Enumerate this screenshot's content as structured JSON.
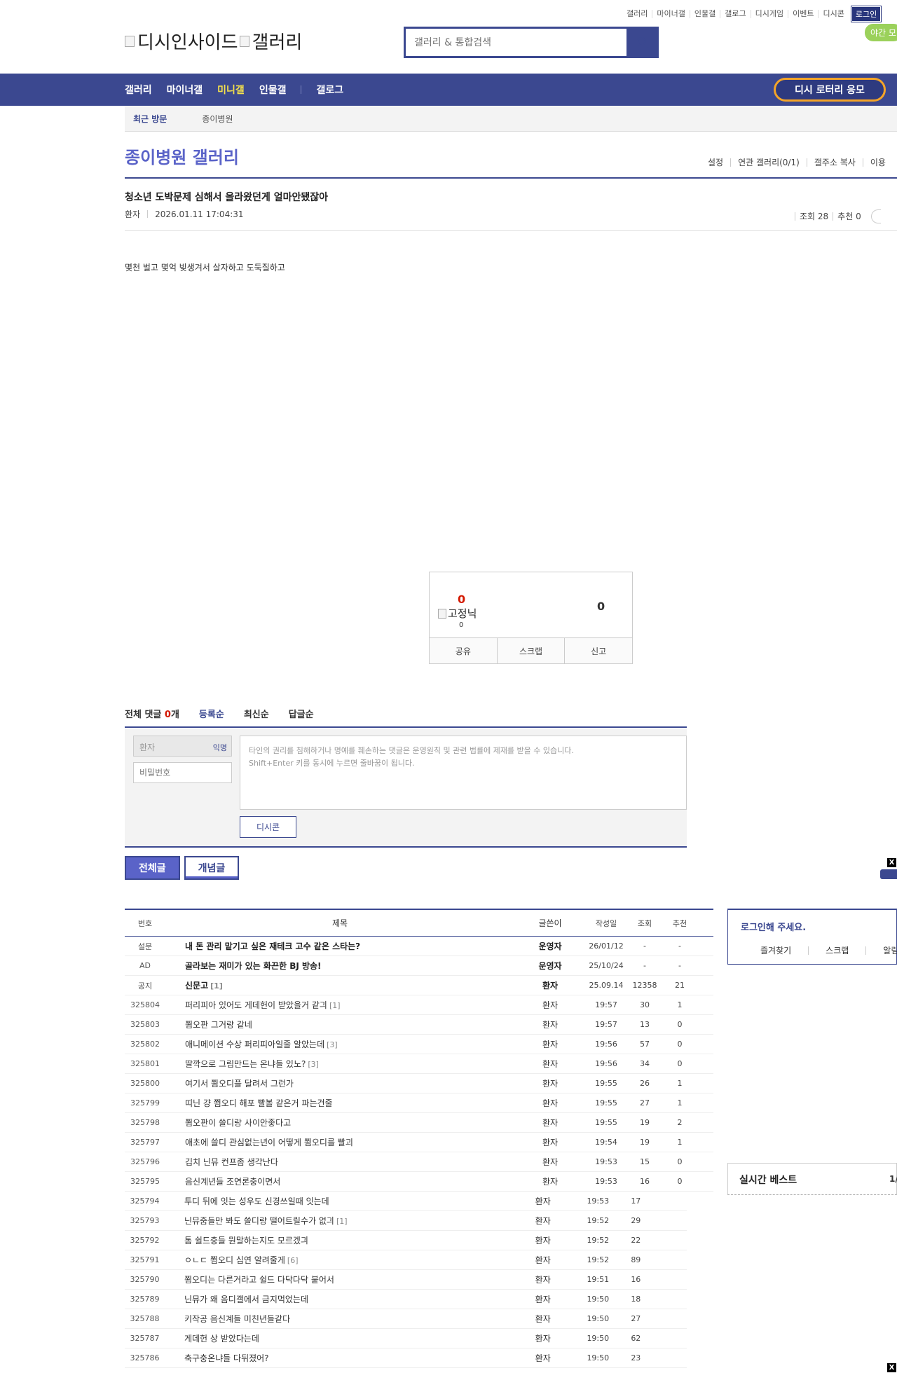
{
  "topmenu": {
    "items": [
      "갤러리",
      "마이너갤",
      "인물갤",
      "갤로그",
      "디시게임",
      "이벤트",
      "디시콘"
    ],
    "login_label": "로그인",
    "night_label": "야간 모"
  },
  "logo": {
    "site_alt": "디시인사이드",
    "gallery_alt": "갤러리"
  },
  "search": {
    "placeholder": "갤러리 & 통합검색"
  },
  "gnb": {
    "items": [
      "갤러리",
      "마이너갤",
      "미니갤",
      "인물갤"
    ],
    "extra": "갤로그",
    "lotto_label": "디시 로터리 응모"
  },
  "visit": {
    "title": "최근 방문",
    "gallery": "종이병원"
  },
  "gallery": {
    "title": "종이병원 갤러리",
    "options": [
      "설정",
      "연관 갤러리(0/1)",
      "갤주소 복사",
      "이용"
    ]
  },
  "post": {
    "title": "청소년 도박문제 심해서 올라왔던게 얼마안됐잖아",
    "writer": "환자",
    "datetime": "2026.01.11 17:04:31",
    "views_label": "조회 28",
    "rec_label": "추천 0",
    "body": "몇천 벌고 몇억 빚생겨서 살자하고 도둑질하고"
  },
  "recommend": {
    "up": "0",
    "fixed_alt": "고정닉",
    "fixed_count": "0",
    "down": "0",
    "buttons": [
      "공유",
      "스크랩",
      "신고"
    ]
  },
  "comments": {
    "total_label": "전체 댓글",
    "total_count": "0",
    "total_unit": "개",
    "sorts": [
      "등록순",
      "최신순",
      "답글순"
    ],
    "nick": "환자",
    "anon_label": "익명",
    "pw_placeholder": "비밀번호",
    "notice_line1": "타인의 권리를 침해하거나 명예를 훼손하는 댓글은 운영원칙 및 관련 법률에 제재를 받을 수 있습니다.",
    "notice_line2": "Shift+Enter 키를 동시에 누르면 줄바꿈이 됩니다.",
    "dccon_label": "디시콘"
  },
  "board_tabs": {
    "all": "전체글",
    "concept": "개념글"
  },
  "list": {
    "headers": {
      "num": "번호",
      "title": "제목",
      "writer": "글쓴이",
      "date": "작성일",
      "views": "조회",
      "rec": "추천"
    },
    "rows": [
      {
        "num": "설문",
        "title": "내 돈 관리 맡기고 싶은 재테크 고수 같은 스타는?",
        "reply": "",
        "writer": "운영자",
        "date": "26/01/12",
        "views": "-",
        "rec": "-",
        "bold": true
      },
      {
        "num": "AD",
        "title": "골라보는 재미가 있는 화끈한 BJ 방송!",
        "reply": "",
        "writer": "운영자",
        "date": "25/10/24",
        "views": "-",
        "rec": "-",
        "bold": true
      },
      {
        "num": "공지",
        "title": "신문고",
        "reply": "[1]",
        "writer": "환자",
        "date": "25.09.14",
        "views": "12358",
        "rec": "21",
        "bold": true
      },
      {
        "num": "325804",
        "title": "퍼리피아 있어도 게데헌이 받았을거 같긔",
        "reply": "[1]",
        "writer": "환자",
        "date": "19:57",
        "views": "30",
        "rec": "1"
      },
      {
        "num": "325803",
        "title": "쬠오판 그거랑 같네",
        "reply": "",
        "writer": "환자",
        "date": "19:57",
        "views": "13",
        "rec": "0"
      },
      {
        "num": "325802",
        "title": "애니메이션 수상 퍼리피아일줄 알았는데",
        "reply": "[3]",
        "writer": "환자",
        "date": "19:56",
        "views": "57",
        "rec": "0"
      },
      {
        "num": "325801",
        "title": "딸깍으로 그림만드는 온냐들 있노?",
        "reply": "[3]",
        "writer": "환자",
        "date": "19:56",
        "views": "34",
        "rec": "0"
      },
      {
        "num": "325800",
        "title": "여기서 쬠오디플 달려서 그런가",
        "reply": "",
        "writer": "환자",
        "date": "19:55",
        "views": "26",
        "rec": "1"
      },
      {
        "num": "325799",
        "title": "띠닌 걍 쬠오디 해포 빨볼 같은거 파는건줄",
        "reply": "",
        "writer": "환자",
        "date": "19:55",
        "views": "27",
        "rec": "1"
      },
      {
        "num": "325798",
        "title": "쬠오판이 쓸디랑 사이안좋다고",
        "reply": "",
        "writer": "환자",
        "date": "19:55",
        "views": "19",
        "rec": "2"
      },
      {
        "num": "325797",
        "title": "애초에 쓸디 관심없는년이 어떻게 쬠오디를 빨괴",
        "reply": "",
        "writer": "환자",
        "date": "19:54",
        "views": "19",
        "rec": "1"
      },
      {
        "num": "325796",
        "title": "김치 닌뮤 컨프좀 생각난다",
        "reply": "",
        "writer": "환자",
        "date": "19:53",
        "views": "15",
        "rec": "0"
      },
      {
        "num": "325795",
        "title": "음신계년들 조연론충이면서",
        "reply": "",
        "writer": "환자",
        "date": "19:53",
        "views": "16",
        "rec": "0"
      },
      {
        "num": "325794",
        "title": "투디 뒤에 잇는 성우도 신경쓰일때 잇는데",
        "reply": "",
        "writer": "환자",
        "date": "19:53",
        "views": "17",
        "rec": ""
      },
      {
        "num": "325793",
        "title": "닌뮤줌들만 봐도 쓸디랑 떨어트릴수가 없긔",
        "reply": "[1]",
        "writer": "환자",
        "date": "19:52",
        "views": "29",
        "rec": ""
      },
      {
        "num": "325792",
        "title": "톰 쉴드충들 뭔말하는지도 모르겠긔",
        "reply": "",
        "writer": "환자",
        "date": "19:52",
        "views": "22",
        "rec": ""
      },
      {
        "num": "325791",
        "title": "ㅇㄴㄷ 쬠오디 심연 알려줄게",
        "reply": "[6]",
        "writer": "환자",
        "date": "19:52",
        "views": "89",
        "rec": ""
      },
      {
        "num": "325790",
        "title": "쬠오디는 다른거라고 쉴드 다닥다닥 붙어서",
        "reply": "",
        "writer": "환자",
        "date": "19:51",
        "views": "16",
        "rec": ""
      },
      {
        "num": "325789",
        "title": "닌뮤가 왜 음디갤에서 금지먹었는데",
        "reply": "",
        "writer": "환자",
        "date": "19:50",
        "views": "18",
        "rec": ""
      },
      {
        "num": "325788",
        "title": "키작공 음신계들 미친년들같다",
        "reply": "",
        "writer": "환자",
        "date": "19:50",
        "views": "27",
        "rec": ""
      },
      {
        "num": "325787",
        "title": "게데헌 상 받았다는데",
        "reply": "",
        "writer": "환자",
        "date": "19:50",
        "views": "62",
        "rec": ""
      },
      {
        "num": "325786",
        "title": "축구충온냐들 다뒤졌어?",
        "reply": "",
        "writer": "환자",
        "date": "19:50",
        "views": "23",
        "rec": ""
      }
    ]
  },
  "sidebar": {
    "login_title": "로그인해 주세요.",
    "login_links": [
      "즐겨찾기",
      "스크랩",
      "알림"
    ],
    "best_title": "실시간 베스트",
    "best_page": "1/"
  },
  "close_label": "X"
}
